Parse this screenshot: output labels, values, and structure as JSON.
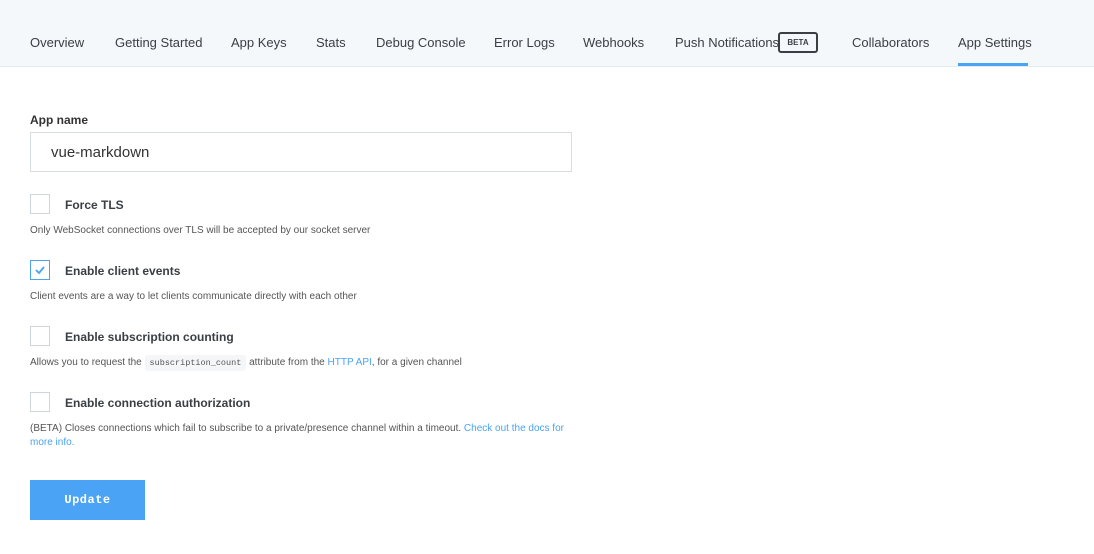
{
  "nav": {
    "tabs": [
      {
        "label": "Overview"
      },
      {
        "label": "Getting Started"
      },
      {
        "label": "App Keys"
      },
      {
        "label": "Stats"
      },
      {
        "label": "Debug Console"
      },
      {
        "label": "Error Logs"
      },
      {
        "label": "Webhooks"
      },
      {
        "label": "Push Notifications",
        "badge": "BETA"
      },
      {
        "label": "Collaborators"
      },
      {
        "label": "App Settings",
        "active": true
      }
    ]
  },
  "form": {
    "app_name_label": "App name",
    "app_name_value": "vue-markdown",
    "options": [
      {
        "label": "Force TLS",
        "checked": false,
        "help": "Only WebSocket connections over TLS will be accepted by our socket server"
      },
      {
        "label": "Enable client events",
        "checked": true,
        "help": "Client events are a way to let clients communicate directly with each other"
      },
      {
        "label": "Enable subscription counting",
        "checked": false,
        "help_before": "Allows you to request the",
        "help_code": "subscription_count",
        "help_mid": "attribute from the",
        "help_link": "HTTP API",
        "help_after": ", for a given channel"
      },
      {
        "label": "Enable connection authorization",
        "checked": false,
        "help": "(BETA) Closes connections which fail to subscribe to a private/presence channel within a timeout.",
        "help_link": "Check out the docs for more info."
      }
    ],
    "update_label": "Update"
  },
  "colors": {
    "accent": "#4aa3f5",
    "nav_bg": "#f5f8fa"
  }
}
